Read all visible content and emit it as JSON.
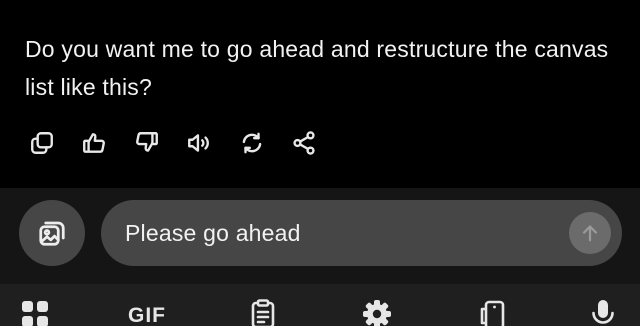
{
  "conversation": {
    "assistant_message": "Do you want me to go ahead and restructure the canvas list like this?"
  },
  "message_actions": [
    {
      "name": "copy-icon"
    },
    {
      "name": "thumbs-up-icon"
    },
    {
      "name": "thumbs-down-icon"
    },
    {
      "name": "read-aloud-icon"
    },
    {
      "name": "regenerate-icon"
    },
    {
      "name": "share-icon"
    }
  ],
  "composer": {
    "input_value": "Please go ahead",
    "attach_icon": "image-gallery-icon",
    "send_icon": "arrow-up-icon"
  },
  "keyboard_toolbar": {
    "gif_label": "GIF",
    "items": [
      "apps-grid-icon",
      "gif",
      "clipboard-icon",
      "settings-gear-icon",
      "phone-mode-icon",
      "microphone-icon"
    ]
  },
  "colors": {
    "background": "#000000",
    "composer_background": "#151515",
    "pill": "#464646",
    "send_button": "#6b6b6b",
    "keyboard_bar": "#1f1f1f",
    "text": "#f2f2f2"
  }
}
